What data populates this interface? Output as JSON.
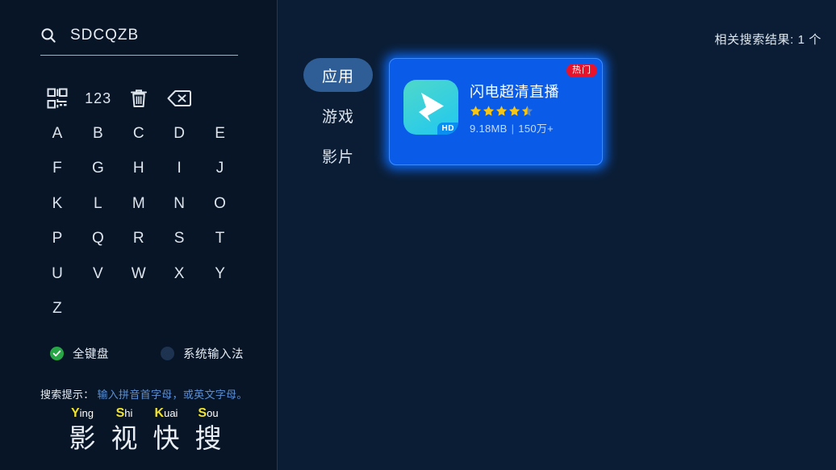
{
  "search": {
    "icon": "search-icon",
    "query": "SDCQZB",
    "placeholder": "SDCQZB"
  },
  "keyboard": {
    "function_keys": [
      {
        "name": "qr-code-icon",
        "label": ""
      },
      {
        "name": "numeric-key",
        "label": "123"
      },
      {
        "name": "trash-icon",
        "label": ""
      },
      {
        "name": "backspace-icon",
        "label": ""
      }
    ],
    "letters": [
      [
        "A",
        "B",
        "C",
        "D",
        "E"
      ],
      [
        "F",
        "G",
        "H",
        "I",
        "J"
      ],
      [
        "K",
        "L",
        "M",
        "N",
        "O"
      ],
      [
        "P",
        "Q",
        "R",
        "S",
        "T"
      ],
      [
        "U",
        "V",
        "W",
        "X",
        "Y"
      ],
      [
        "Z",
        "",
        "",
        "",
        ""
      ]
    ]
  },
  "input_options": [
    {
      "label": "全键盘",
      "selected": true
    },
    {
      "label": "系统输入法",
      "selected": false
    }
  ],
  "hint": {
    "label": "搜索提示：",
    "value": "输入拼音首字母，或英文字母。"
  },
  "logo": {
    "pinyin": [
      {
        "cap": "Y",
        "rest": "ing"
      },
      {
        "cap": "S",
        "rest": "hi"
      },
      {
        "cap": "K",
        "rest": "uai"
      },
      {
        "cap": "S",
        "rest": "ou"
      }
    ],
    "characters": [
      "影",
      "视",
      "快",
      "搜"
    ],
    "accent_color": "#f2e32a"
  },
  "results": {
    "count_text": "相关搜索结果: 1 个",
    "categories": [
      {
        "label": "应用",
        "active": true
      },
      {
        "label": "游戏",
        "active": false
      },
      {
        "label": "影片",
        "active": false
      }
    ],
    "apps": [
      {
        "title": "闪电超清直播",
        "badge": "热门",
        "badge_color": "#e8132b",
        "rating": 4.5,
        "size": "9.18MB",
        "separator": "|",
        "downloads": "150万+",
        "icon_label": "HD",
        "focused": true,
        "card_color": "#0a5ce8"
      }
    ]
  }
}
